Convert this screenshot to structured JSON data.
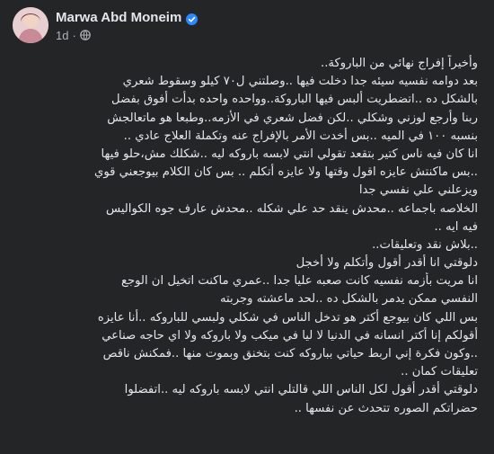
{
  "post": {
    "author": "Marwa Abd Moneim",
    "time": "1d",
    "dot": "·",
    "icons": {
      "avatar": "profile-avatar",
      "verified": "verified-badge-icon",
      "audience": "globe-icon"
    },
    "colors": {
      "background": "#242526",
      "text": "#e4e6eb",
      "muted": "#b0b3b8",
      "verified": "#2d88ff"
    },
    "lines": [
      "وأخيراً إفراج نهائي من الباروكة..",
      "بعد دوامه نفسيه سيئه جدا دخلت فيها ..وصلتني ل٧٠ كيلو وسقوط شعري",
      "بالشكل ده ..اتضطريت ألبس فيها الباروكة..وواحده واحده بدأت أفوق بفضل",
      "ربنا وأرجع لوزني وشكلي ..لكن فضل شعري في الأزمه..وطبعا هو ماتعالجش",
      "بنسبه ١٠٠ في الميه ..بس أخدت الأمر بالإفراج عنه وتكملة العلاج عادي ..",
      "انا كان فيه ناس كتير بتقعد تقولي انتي لابسه باروكه ليه ..شكلك مش،حلو فيها",
      "..بس ماكنتش عايزه اقول وقتها ولا عايزه أتكلم .. بس كان الكلام بيوجعني قوي",
      "ويزعلني علي نفسي جدا",
      "الخلاصه باجماعه ..محدش ينقد حد علي شكله ..محدش عارف جوه الكواليس",
      "فيه ايه ..",
      "..بلاش نقد وتعليقات..",
      "دلوقتي انا أقدر أقول وأتكلم ولا أخجل",
      "انا مريت بأزمه نفسيه كانت صعبه عليا جدا ..عمري ماكنت اتخيل ان الوجع",
      "النفسي ممكن يدمر بالشكل ده ..لحد ماعشته وجربته",
      "بس اللي كان بيوجع أكتر هو تدخل الناس في شكلي ولبسي للباروكه ..أنا عايزه",
      "أقولكم إنا أكتر انسانه في الدنيا لا ليا في ميكب ولا باروكه ولا اي حاجه صناعي",
      "..وكون فكرة إني اربط حياتي بباروكه كنت بتخنق وبموت منها ..فمكنش ناقص",
      "تعليقات كمان ..",
      "دلوقتي أقدر أقول لكل الناس اللي قالتلي انتي لابسه باروكه ليه ..اتفضلوا",
      "حضراتكم الصوره تتحدث عن نفسها .."
    ]
  }
}
